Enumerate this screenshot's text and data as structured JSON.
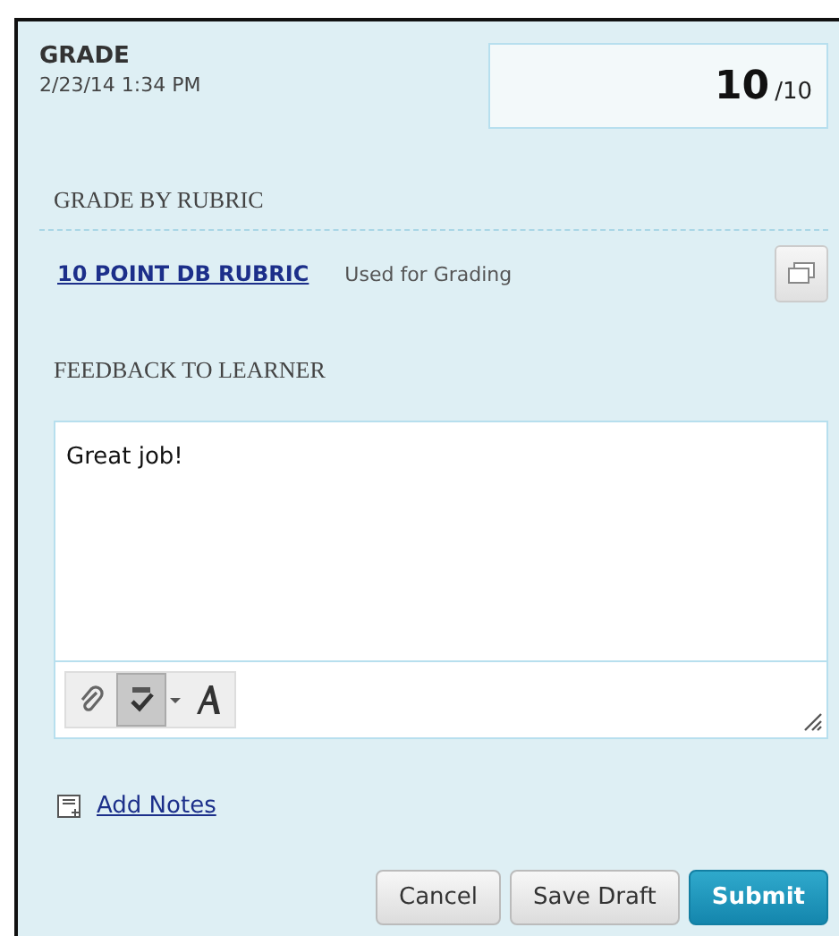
{
  "grade": {
    "title": "GRADE",
    "date": "2/23/14 1:34 PM",
    "score": "10",
    "out_of": "/10"
  },
  "rubric": {
    "heading": "GRADE BY RUBRIC",
    "link": "10 POINT DB RUBRIC",
    "status": "Used for Grading"
  },
  "feedback": {
    "heading": "FEEDBACK TO LEARNER",
    "value": "Great job!",
    "tools": [
      {
        "kind": "attach",
        "pressed": false
      },
      {
        "kind": "spellcheck",
        "pressed": true
      },
      {
        "kind": "font",
        "pressed": false
      }
    ]
  },
  "add_notes": "Add Notes",
  "buttons": [
    {
      "label": "Cancel",
      "kind": "secondary"
    },
    {
      "label": "Save Draft",
      "kind": "secondary"
    },
    {
      "label": "Submit",
      "kind": "primary"
    }
  ]
}
